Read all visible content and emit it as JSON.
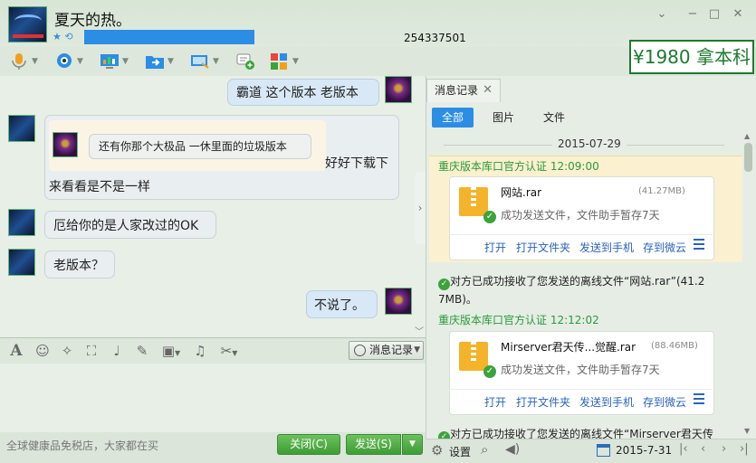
{
  "window": {
    "nickname": "夏天的热。",
    "qq_number": "254337501",
    "title_icons": "★ ⟲",
    "controls": {
      "minimize": "−",
      "maximize": "□",
      "close": "✕",
      "menu": "⌄"
    }
  },
  "brand_badge": "¥1980 拿本科",
  "toolbar": {
    "items": [
      "voice-call",
      "video-call",
      "remote-desktop",
      "send-file",
      "share-screen",
      "create-group",
      "apps"
    ]
  },
  "chat": {
    "messages": [
      {
        "from": "me",
        "text": "霸道 这个版本 老版本"
      },
      {
        "from": "other",
        "quote": "还有你那个大极品 一休里面的垃圾版本",
        "text_line1": "好好下载下",
        "text_line2": "来看看是不是一样"
      },
      {
        "from": "other",
        "text": "厄给你的是人家改过的OK"
      },
      {
        "from": "other",
        "text": "老版本？"
      },
      {
        "from": "me",
        "text": "不说了。"
      }
    ],
    "history_button": "消息记录"
  },
  "input_toolbar": {
    "icons": [
      "font-icon",
      "emoji-icon",
      "magic-icon",
      "screenshot-icon",
      "mic-icon",
      "edit-icon",
      "image-icon",
      "music-icon",
      "scissors-icon"
    ]
  },
  "bottom": {
    "ad_text": "全球健康品免税店，大家都在买",
    "close_label": "关闭(C)",
    "send_label": "发送(S)"
  },
  "history_panel": {
    "tab_title": "消息记录",
    "filters": [
      "全部",
      "图片",
      "文件"
    ],
    "date": "2015-07-29",
    "entries": [
      {
        "sender": "重庆版本库口官方认证",
        "time": "12:09:00",
        "file_name": "网站.rar",
        "file_size": "(41.27MB)",
        "status": "成功发送文件，文件助手暂存7天",
        "actions": [
          "打开",
          "打开文件夹",
          "发送到手机",
          "存到微云"
        ]
      },
      {
        "system_line1": "对方已成功接收了您发送的离线文件“网站.rar”(41.2",
        "system_line2": "7MB)。"
      },
      {
        "sender": "重庆版本库口官方认证",
        "time": "12:12:02",
        "file_name": "Mirserver君天传...觉醒.rar",
        "file_size": "(88.46MB)",
        "status": "成功发送文件，文件助手暂存7天",
        "actions": [
          "打开",
          "打开文件夹",
          "发送到手机",
          "存到微云"
        ]
      },
      {
        "system_line1": "对方已成功接收了您发送的离线文件“Mirserver君天传"
      }
    ],
    "footer": {
      "settings": "设置",
      "date": "2015-7-31"
    }
  },
  "colors": {
    "accent_blue": "#2b8de4",
    "green_button": "#3e9d35",
    "sender_green": "#2a9a3a",
    "highlight": "#fbf0cf"
  }
}
